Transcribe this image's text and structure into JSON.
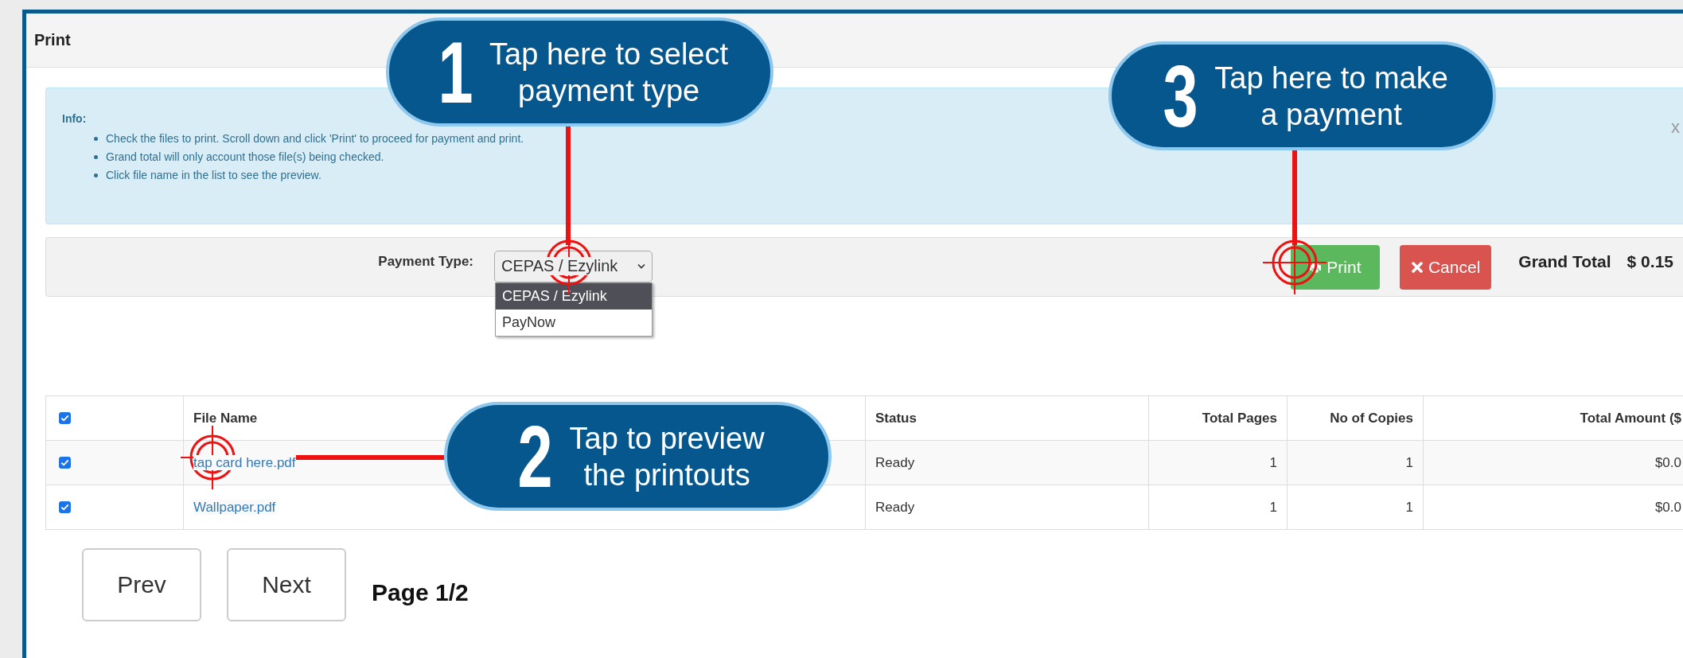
{
  "header": {
    "title": "Print"
  },
  "info": {
    "title": "Info:",
    "close": "x",
    "items": [
      "Check the files to print. Scroll down and click 'Print' to proceed for payment and print.",
      "Grand total will only account those file(s) being checked.",
      "Click file name in the list to see the preview."
    ]
  },
  "payment": {
    "label": "Payment Type:",
    "value": "CEPAS / Ezylink",
    "expanded": true,
    "options": [
      {
        "label": "CEPAS / Ezylink",
        "selected": true
      },
      {
        "label": "PayNow",
        "selected": false
      }
    ]
  },
  "actions": {
    "print": "Print",
    "cancel": "Cancel",
    "grand_total_label": "Grand Total",
    "grand_total": "$ 0.15"
  },
  "table": {
    "all_checked": true,
    "columns": [
      "File Name",
      "Status",
      "Total Pages",
      "No of Copies",
      "Total Amount ($"
    ],
    "rows": [
      {
        "checked": true,
        "file": "tap card here.pdf",
        "status": "Ready",
        "pages": "1",
        "copies": "1",
        "amount": "$0.0"
      },
      {
        "checked": true,
        "file": "Wallpaper.pdf",
        "status": "Ready",
        "pages": "1",
        "copies": "1",
        "amount": "$0.0"
      }
    ]
  },
  "pager": {
    "prev": "Prev",
    "next": "Next",
    "page": "Page 1/2"
  },
  "callouts": [
    {
      "number": "1",
      "lines": [
        "Tap here to select",
        "payment type"
      ]
    },
    {
      "number": "2",
      "lines": [
        "Tap to preview",
        "the printouts"
      ]
    },
    {
      "number": "3",
      "lines": [
        "Tap here to make",
        "a payment"
      ]
    }
  ]
}
